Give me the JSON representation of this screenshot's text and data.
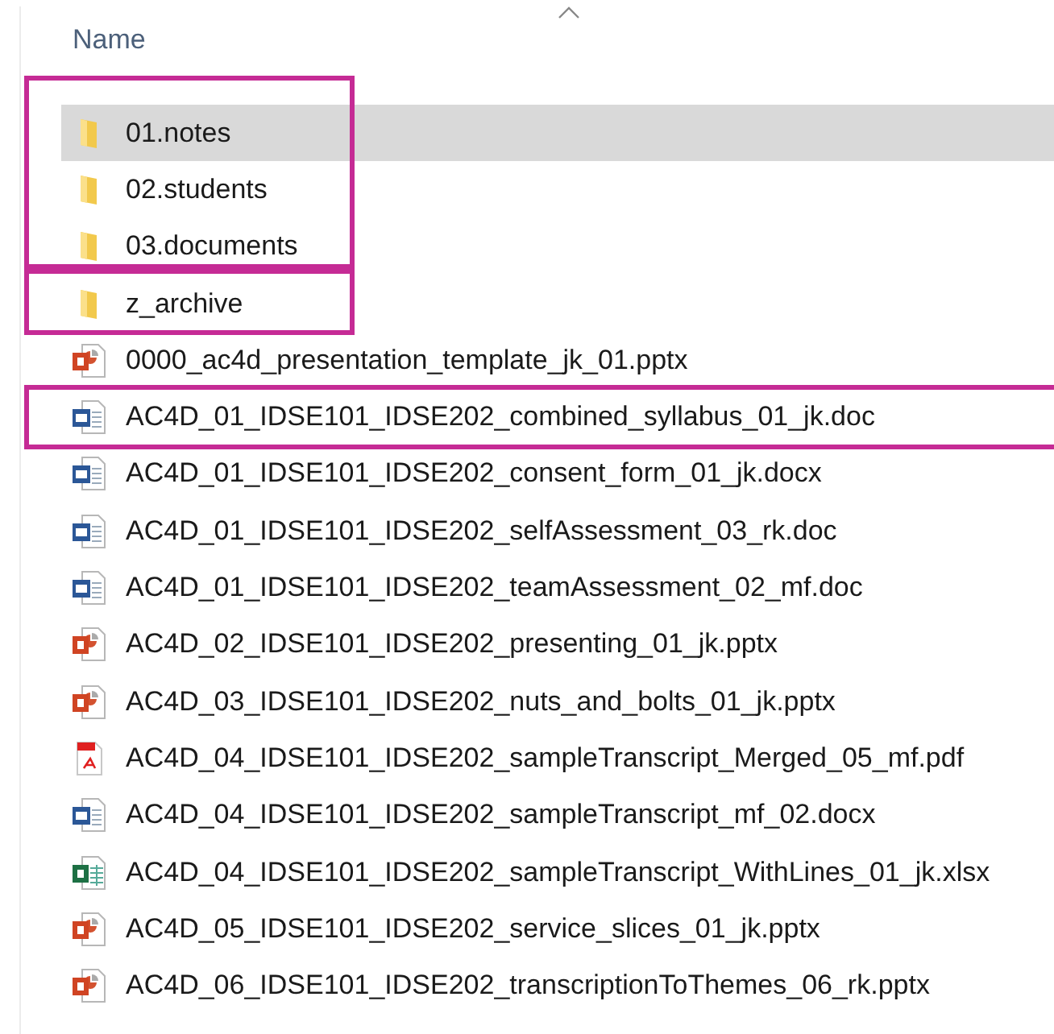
{
  "header": {
    "name_column": "Name"
  },
  "groups": [
    {
      "kind": "narrow",
      "files": [
        {
          "name": "01.notes",
          "kind": "folder",
          "selected": true
        },
        {
          "name": "02.students",
          "kind": "folder",
          "selected": false
        },
        {
          "name": "03.documents",
          "kind": "folder",
          "selected": false
        }
      ]
    },
    {
      "kind": "narrow",
      "files": [
        {
          "name": "z_archive",
          "kind": "folder",
          "selected": false
        }
      ]
    },
    {
      "kind": "plain",
      "files": [
        {
          "name": "0000_ac4d_presentation_template_jk_01.pptx",
          "kind": "powerpoint",
          "selected": false
        }
      ]
    },
    {
      "kind": "wide",
      "files": [
        {
          "name": "AC4D_01_IDSE101_IDSE202_combined_syllabus_01_jk.doc",
          "kind": "word",
          "selected": false
        }
      ]
    },
    {
      "kind": "plain",
      "files": [
        {
          "name": "AC4D_01_IDSE101_IDSE202_consent_form_01_jk.docx",
          "kind": "word",
          "selected": false
        },
        {
          "name": "AC4D_01_IDSE101_IDSE202_selfAssessment_03_rk.doc",
          "kind": "word",
          "selected": false
        },
        {
          "name": "AC4D_01_IDSE101_IDSE202_teamAssessment_02_mf.doc",
          "kind": "word",
          "selected": false
        },
        {
          "name": "AC4D_02_IDSE101_IDSE202_presenting_01_jk.pptx",
          "kind": "powerpoint",
          "selected": false
        },
        {
          "name": "AC4D_03_IDSE101_IDSE202_nuts_and_bolts_01_jk.pptx",
          "kind": "powerpoint",
          "selected": false
        },
        {
          "name": "AC4D_04_IDSE101_IDSE202_sampleTranscript_Merged_05_mf.pdf",
          "kind": "pdf",
          "selected": false
        },
        {
          "name": "AC4D_04_IDSE101_IDSE202_sampleTranscript_mf_02.docx",
          "kind": "word",
          "selected": false
        },
        {
          "name": "AC4D_04_IDSE101_IDSE202_sampleTranscript_WithLines_01_jk.xlsx",
          "kind": "excel",
          "selected": false
        },
        {
          "name": "AC4D_05_IDSE101_IDSE202_service_slices_01_jk.pptx",
          "kind": "powerpoint",
          "selected": false
        },
        {
          "name": "AC4D_06_IDSE101_IDSE202_transcriptionToThemes_06_rk.pptx",
          "kind": "powerpoint",
          "selected": false
        }
      ]
    }
  ]
}
